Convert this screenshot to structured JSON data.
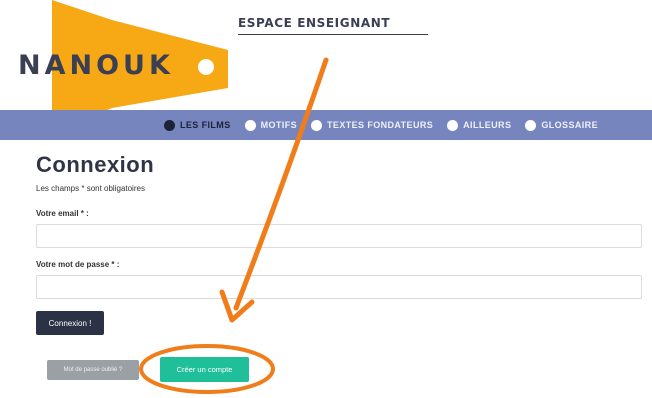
{
  "brand": {
    "logo_text": "NANOUK",
    "pennant_color": "#f6a915",
    "section_title": "ESPACE ENSEIGNANT"
  },
  "nav": {
    "items": [
      {
        "label": "LES FILMS",
        "active": true
      },
      {
        "label": "MOTIFS",
        "active": false
      },
      {
        "label": "TEXTES FONDATEURS",
        "active": false
      },
      {
        "label": "AILLEURS",
        "active": false
      },
      {
        "label": "GLOSSAIRE",
        "active": false
      }
    ],
    "bar_color": "#7785bf"
  },
  "form": {
    "title": "Connexion",
    "required_note": "Les champs * sont obligatoires",
    "email_label": "Votre email * :",
    "email_value": "",
    "password_label": "Votre mot de passe * :",
    "password_value": "",
    "submit_label": "Connexion !"
  },
  "links": {
    "forgot_label": "Mot de passe oublié ?",
    "create_label": "Créer un compte"
  },
  "annotation": {
    "color": "#f07d1a",
    "shape": "arrow-and-ellipse"
  }
}
